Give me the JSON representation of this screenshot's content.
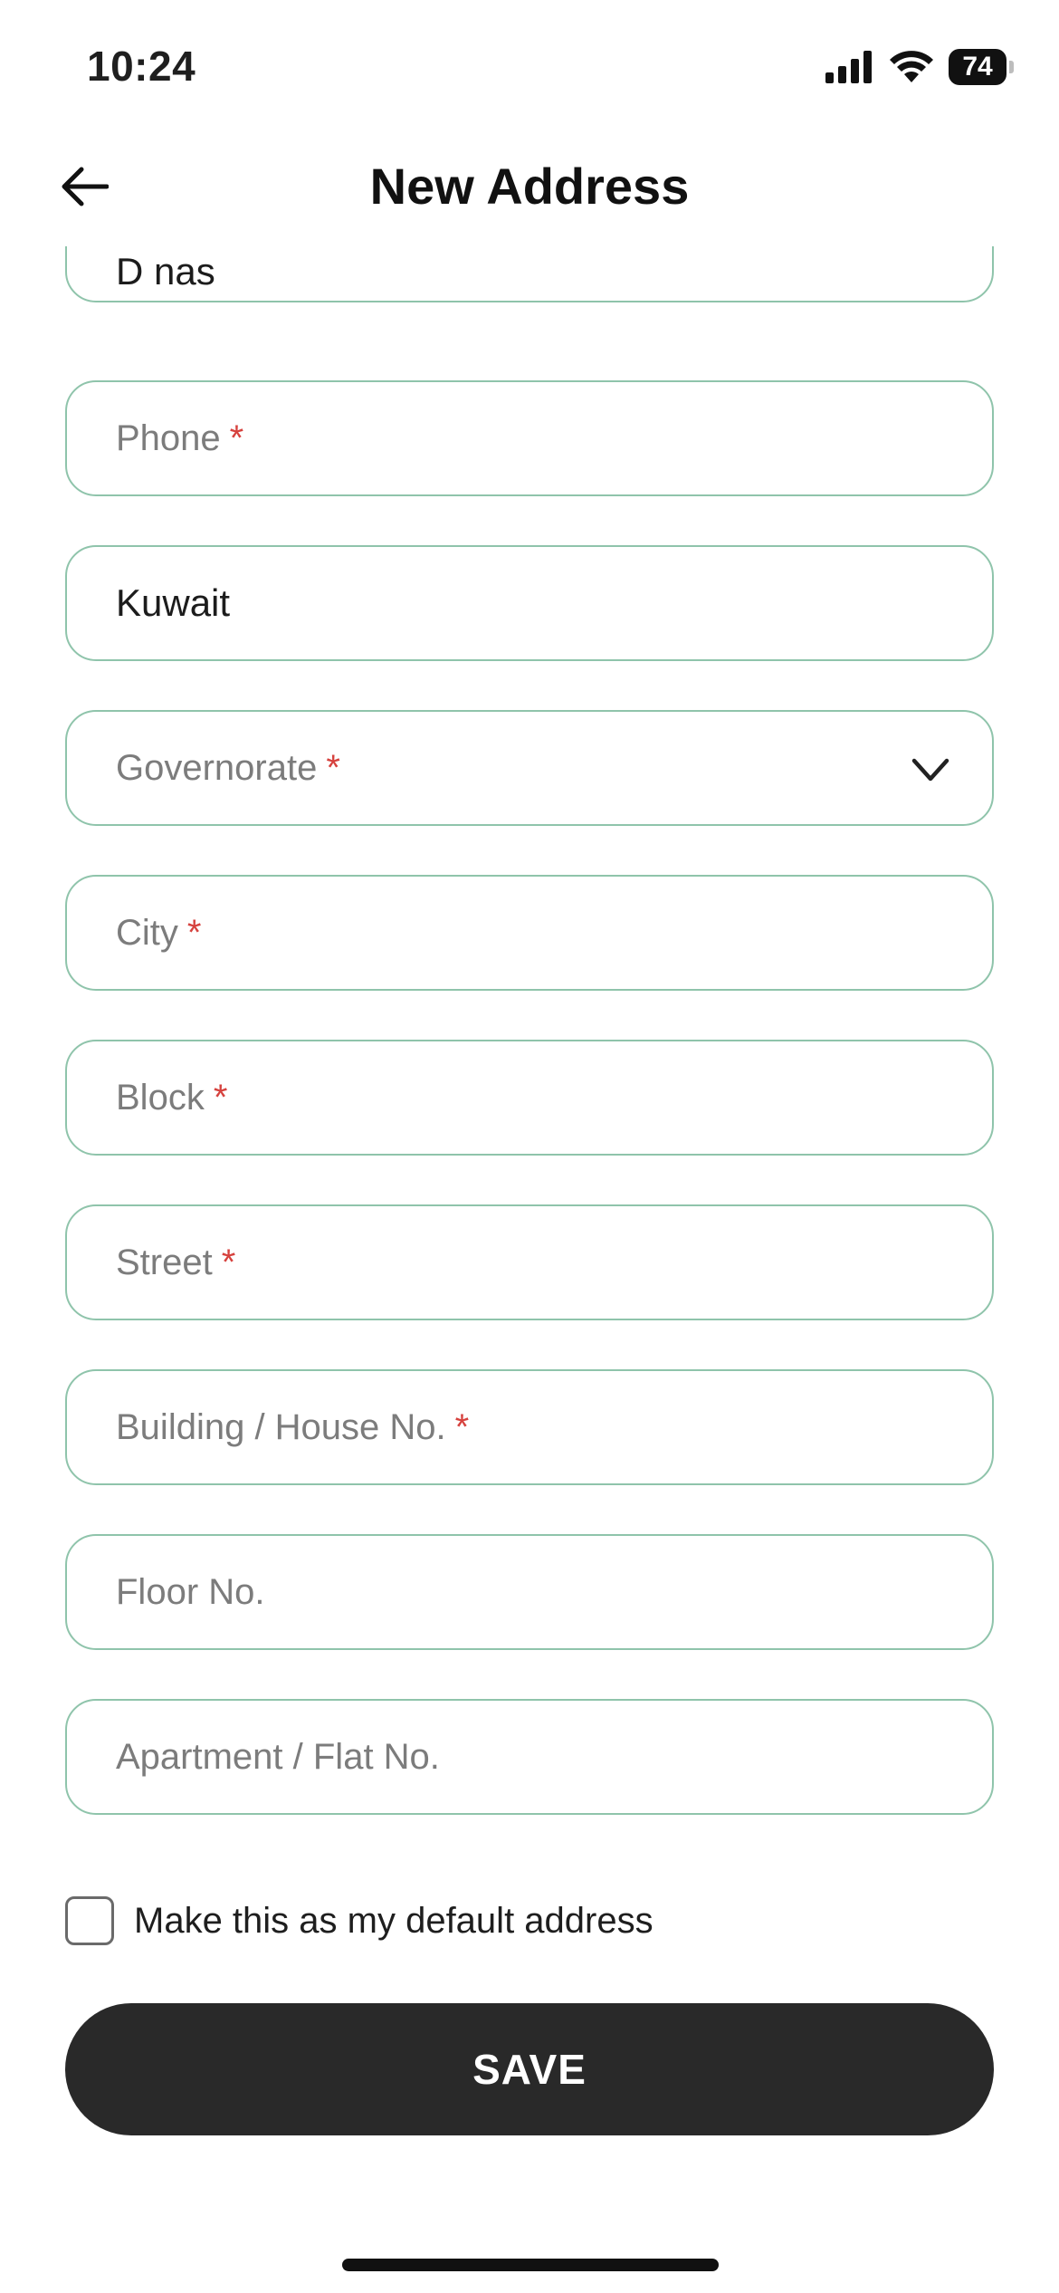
{
  "status_bar": {
    "time": "10:24",
    "battery": "74"
  },
  "header": {
    "title": "New Address"
  },
  "form": {
    "name_value": "D nas",
    "phone": {
      "placeholder": "Phone",
      "required": "*"
    },
    "country_value": "Kuwait",
    "governorate": {
      "placeholder": "Governorate",
      "required": "*"
    },
    "city": {
      "placeholder": "City",
      "required": "*"
    },
    "block": {
      "placeholder": "Block",
      "required": "*"
    },
    "street": {
      "placeholder": "Street",
      "required": "*"
    },
    "building": {
      "placeholder": "Building / House No.",
      "required": "*"
    },
    "floor": {
      "placeholder": "Floor No."
    },
    "apartment": {
      "placeholder": "Apartment / Flat No."
    },
    "default_checkbox": {
      "label": "Make this as my default address",
      "checked": false
    }
  },
  "actions": {
    "save_label": "SAVE"
  },
  "colors": {
    "field_border": "#8fc4ab",
    "required_asterisk": "#d6423e",
    "button_bg": "#292929"
  }
}
